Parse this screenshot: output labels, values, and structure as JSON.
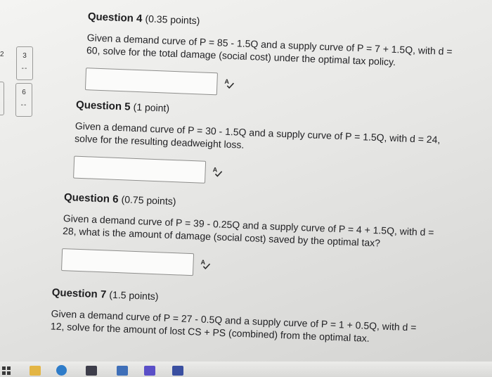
{
  "sidebar": {
    "edge_number": "2",
    "tiles": [
      {
        "number": "3",
        "dash": "--"
      },
      {
        "number": "6",
        "dash": "--"
      }
    ]
  },
  "questions": [
    {
      "title": "Question 4",
      "points": "(0.35 points)",
      "line1": "Given a demand curve of P = 85 - 1.5Q and a supply curve of P = 7 + 1.5Q, with d =",
      "line2": "60, solve for the total damage (social cost) under the optimal tax policy.",
      "answer_value": ""
    },
    {
      "title": "Question 5",
      "points": "(1 point)",
      "line1": "Given a demand curve of P = 30 - 1.5Q and a supply curve of P = 1.5Q, with d = 24,",
      "line2": "solve for the resulting deadweight loss.",
      "answer_value": ""
    },
    {
      "title": "Question 6",
      "points": "(0.75 points)",
      "line1": "Given a demand curve of P = 39 - 0.25Q and a supply curve of P = 4 + 1.5Q, with d =",
      "line2": "28, what is the amount of damage (social cost) saved by the optimal tax?",
      "answer_value": ""
    },
    {
      "title": "Question 7",
      "points": "(1.5 points)",
      "line1": "Given a demand curve of P = 27 - 0.5Q and a supply curve of P = 1 + 0.5Q, with d =",
      "line2": "12, solve for the amount of lost CS + PS (combined) from the optimal tax."
    }
  ],
  "icons": {
    "spellcheck": "spellcheck-icon",
    "taskbar": [
      "start-icon",
      "file-explorer-icon",
      "edge-browser-icon",
      "store-icon",
      "mail-icon",
      "chat-icon",
      "teams-icon"
    ]
  },
  "colors": {
    "text": "#1d1d1f",
    "box_border": "#8e8e8c",
    "edge_blue": "#2e7cc9",
    "files_yellow": "#e3b544"
  }
}
